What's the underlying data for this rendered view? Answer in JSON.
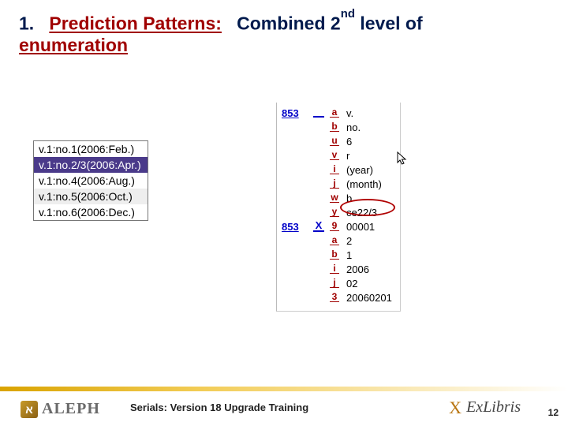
{
  "title": {
    "number": "1.",
    "red_part": "Prediction Patterns:",
    "blue_part_before_sup": "Combined 2",
    "sup": "nd",
    "blue_part_after_sup": " level of",
    "line2": "enumeration"
  },
  "left_table": {
    "rows": [
      {
        "text": "v.1:no.1(2006:Feb.)",
        "sel": false,
        "alt": false
      },
      {
        "text": "v.1:no.2/3(2006:Apr.)",
        "sel": true,
        "alt": false
      },
      {
        "text": "v.1:no.4(2006:Aug.)",
        "sel": false,
        "alt": false
      },
      {
        "text": "v.1:no.5(2006:Oct.)",
        "sel": false,
        "alt": true
      },
      {
        "text": "v.1:no.6(2006:Dec.)",
        "sel": false,
        "alt": false
      }
    ]
  },
  "marc": {
    "block1": {
      "tag": "853",
      "indicator": "",
      "subs": [
        {
          "code": "a",
          "val": "v."
        },
        {
          "code": "b",
          "val": "no."
        },
        {
          "code": "u",
          "val": "6"
        },
        {
          "code": "v",
          "val": "r"
        },
        {
          "code": "i",
          "val": "(year)"
        },
        {
          "code": "j",
          "val": "(month)"
        },
        {
          "code": "w",
          "val": "b"
        },
        {
          "code": "y",
          "val": "ce22/3"
        }
      ]
    },
    "block2": {
      "tag": "853",
      "indicator": "X",
      "subs": [
        {
          "code": "9",
          "val": "00001"
        },
        {
          "code": "a",
          "val": "2"
        },
        {
          "code": "b",
          "val": "1"
        },
        {
          "code": "i",
          "val": "2006"
        },
        {
          "code": "j",
          "val": "02"
        },
        {
          "code": "3",
          "val": "20060201"
        }
      ]
    }
  },
  "footer": {
    "aleph": "ALEPH",
    "aleph_icon_text": "א",
    "text": "Serials: Version 18 Upgrade Training",
    "exlibris_x": "X",
    "exlibris": "ExLibris",
    "page": "12"
  }
}
